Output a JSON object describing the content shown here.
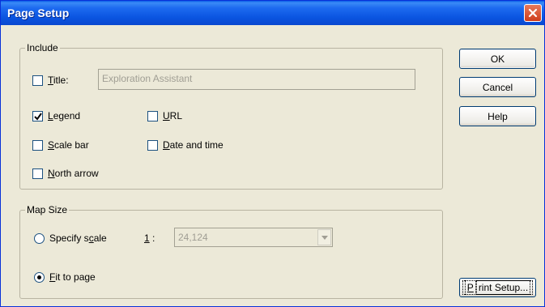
{
  "window": {
    "title": "Page Setup"
  },
  "include": {
    "group_label": "Include",
    "title_label_ul": "T",
    "title_label_rest": "itle:",
    "title_value": "Exploration Assistant",
    "title_checked": false,
    "legend_ul": "L",
    "legend_rest": "egend",
    "legend_checked": true,
    "url_ul": "U",
    "url_rest": "RL",
    "url_checked": false,
    "scalebar_ul": "S",
    "scalebar_rest": "cale bar",
    "scalebar_checked": false,
    "datetime_ul": "D",
    "datetime_rest": "ate and time",
    "datetime_checked": false,
    "northarrow_ul": "N",
    "northarrow_rest": "orth arrow",
    "northarrow_checked": false
  },
  "map_size": {
    "group_label": "Map Size",
    "specify_a": "Specify s",
    "specify_ul": "c",
    "specify_b": "ale",
    "ratio_ul": "1",
    "ratio_rest": ":",
    "scale_value": "24,124",
    "fit_ul": "F",
    "fit_rest": "it to page",
    "selected": "fit"
  },
  "buttons": {
    "ok": "OK",
    "cancel": "Cancel",
    "help": "Help",
    "print_ul": "P",
    "print_rest": "rint Setup..."
  }
}
